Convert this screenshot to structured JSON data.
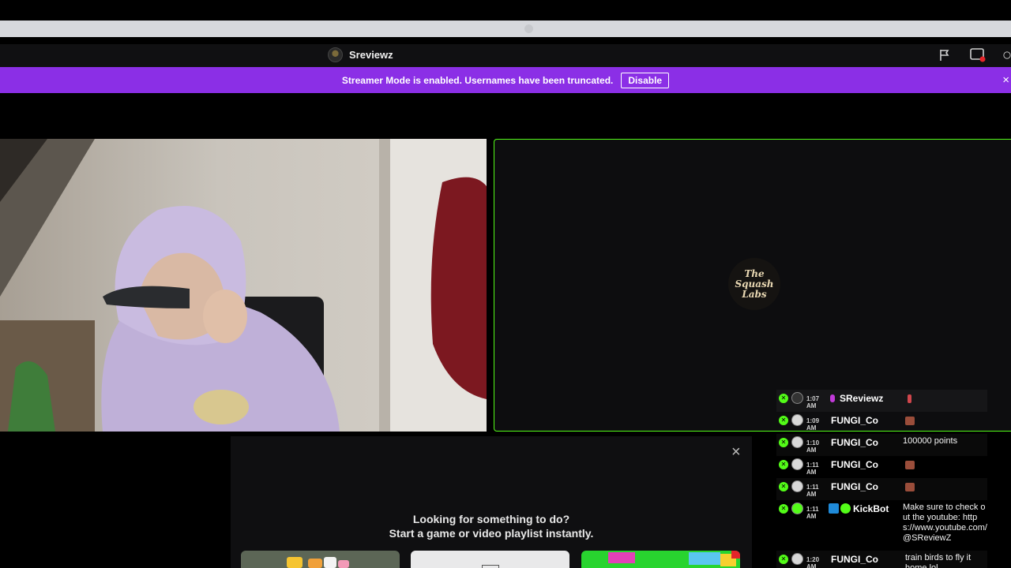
{
  "topbar": {
    "channel_name": "Sreviewz"
  },
  "banner": {
    "message": "Streamer Mode is enabled. Usernames have been truncated.",
    "button_label": "Disable",
    "close_glyph": "×"
  },
  "activity": {
    "close_glyph": "×",
    "title_line1": "Looking for something to do?",
    "title_line2": "Start a game or video playlist instantly."
  },
  "chat": {
    "messages": [
      {
        "time": "1:07 AM",
        "user": "SReviewz",
        "text": ""
      },
      {
        "time": "1:09 AM",
        "user": "FUNGI_Co",
        "text": ""
      },
      {
        "time": "1:10 AM",
        "user": "FUNGI_Co",
        "text": "100000 points"
      },
      {
        "time": "1:11 AM",
        "user": "FUNGI_Co",
        "text": ""
      },
      {
        "time": "1:11 AM",
        "user": "FUNGI_Co",
        "text": ""
      },
      {
        "time": "1:11 AM",
        "user": "KickBot",
        "text": "Make sure to check out the youtube: https://www.youtube.com/@SReviewZ"
      },
      {
        "time": "1:20 AM",
        "user": "FUNGI_Co",
        "text": "train birds to fly it home lol"
      }
    ]
  },
  "colors": {
    "accent": "#53fc18",
    "banner": "#8b2fe6"
  },
  "icons": [
    "flag-icon",
    "theatre-mode-icon",
    "settings-icon",
    "close-icon",
    "verified-badge-icon",
    "mic-icon"
  ]
}
